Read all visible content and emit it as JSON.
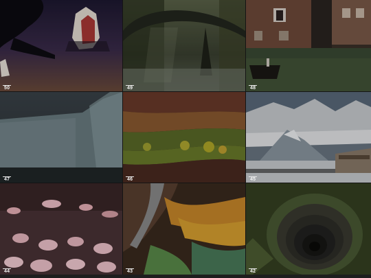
{
  "gallery": {
    "tiles": [
      {
        "number": "50",
        "subject": "night scene with trees and paper lanterns"
      },
      {
        "number": "49",
        "subject": "stone arch bridge in misty forest"
      },
      {
        "number": "48",
        "subject": "Venice canal with buildings and gondola"
      },
      {
        "number": "47",
        "subject": "glacier ice wall"
      },
      {
        "number": "46",
        "subject": "colorful rolling hills at sunset"
      },
      {
        "number": "45",
        "subject": "snowy mountain peaks with observation deck"
      },
      {
        "number": "44",
        "subject": "flock of flamingos"
      },
      {
        "number": "43",
        "subject": "aerial view of colorful river delta"
      },
      {
        "number": "42",
        "subject": "spiral stone well"
      }
    ]
  },
  "colors": {
    "background": "#141414",
    "label": "#f2f2f2"
  }
}
